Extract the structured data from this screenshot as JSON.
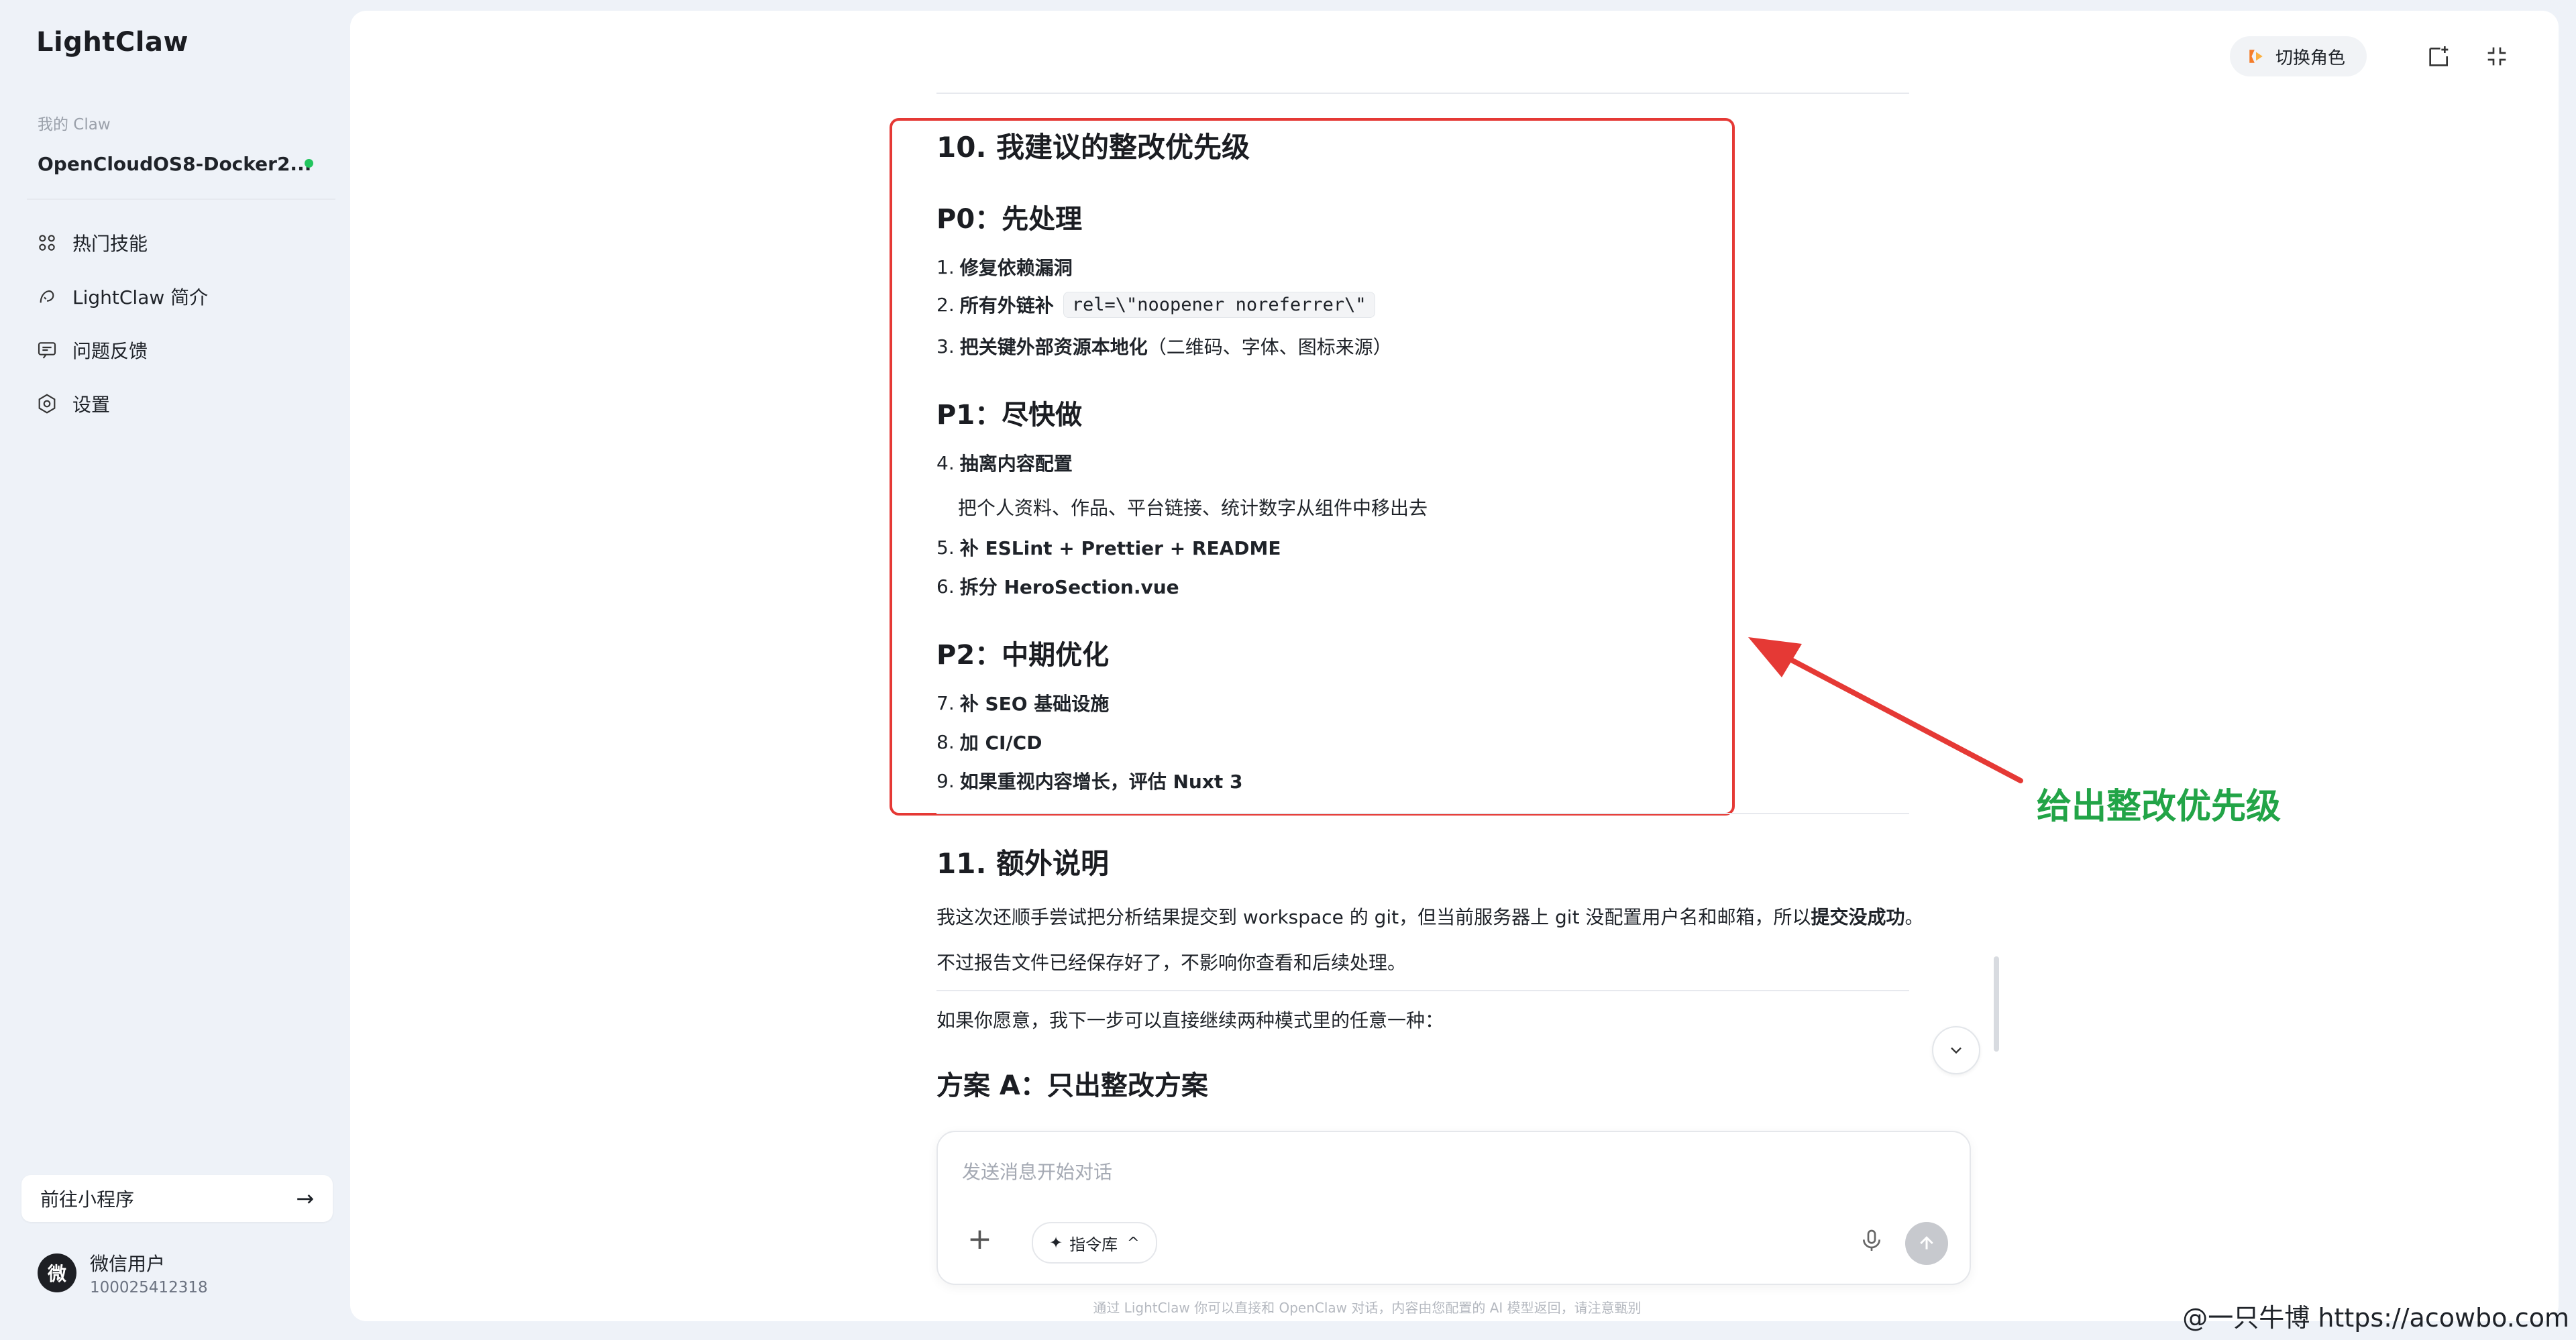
{
  "app": {
    "logo": "LightClaw"
  },
  "sidebar": {
    "section_label": "我的 Claw",
    "claw_name": "OpenCloudOS8-Docker2...",
    "nav": [
      {
        "icon": "skills-icon",
        "label": "热门技能"
      },
      {
        "icon": "claw-intro-icon",
        "label": "LightClaw 简介"
      },
      {
        "icon": "feedback-icon",
        "label": "问题反馈"
      },
      {
        "icon": "settings-icon",
        "label": "设置"
      }
    ],
    "mini_program": {
      "label": "前往小程序",
      "arrow": "→"
    },
    "user": {
      "avatar": "微",
      "name": "微信用户",
      "id": "100025412318"
    }
  },
  "header": {
    "switch_role": "切换角色"
  },
  "message": {
    "s10_title": "10. 我建议的整改优先级",
    "p0_title": "P0：先处理",
    "p0_1": "修复依赖漏洞",
    "p0_2": "所有外链补",
    "p0_2_code": "rel=\\\"noopener noreferrer\\\"",
    "p0_3_bold": "把关键外部资源本地化",
    "p0_3_rest": "（二维码、字体、图标来源）",
    "p1_title": "P1：尽快做",
    "p1_4": "抽离内容配置",
    "p1_4_desc": "把个人资料、作品、平台链接、统计数字从组件中移出去",
    "p1_5": "补 ESLint + Prettier + README",
    "p1_6": "拆分 HeroSection.vue",
    "p2_title": "P2：中期优化",
    "p2_7": "补 SEO 基础设施",
    "p2_8": "加 CI/CD",
    "p2_9": "如果重视内容增长，评估 Nuxt 3",
    "s11_title": "11. 额外说明",
    "s11_p1_a": "我这次还顺手尝试把分析结果提交到 workspace 的 git，但当前服务器上 git 没配置用户名和邮箱，所以",
    "s11_p1_b": "提交没成功",
    "s11_p1_c": "。",
    "s11_p2": "不过报告文件已经保存好了，不影响你查看和后续处理。",
    "s11_p3": "如果你愿意，我下一步可以直接继续两种模式里的任意一种：",
    "planA_title": "方案 A：只出整改方案"
  },
  "input": {
    "placeholder": "发送消息开始对话",
    "plus": "+",
    "commands": "指令库",
    "star": "✦",
    "chevron": "^"
  },
  "footer_note": "通过 LightClaw 你可以直接和 OpenClaw 对话，内容由您配置的 AI 模型返回，请注意甄别",
  "annotation": {
    "text": "给出整改优先级"
  },
  "watermark": "@一只牛博 https://acowbo.com",
  "colors": {
    "highlight_box": "#e53935",
    "annotation": "#22a447",
    "online": "#22c55e"
  }
}
